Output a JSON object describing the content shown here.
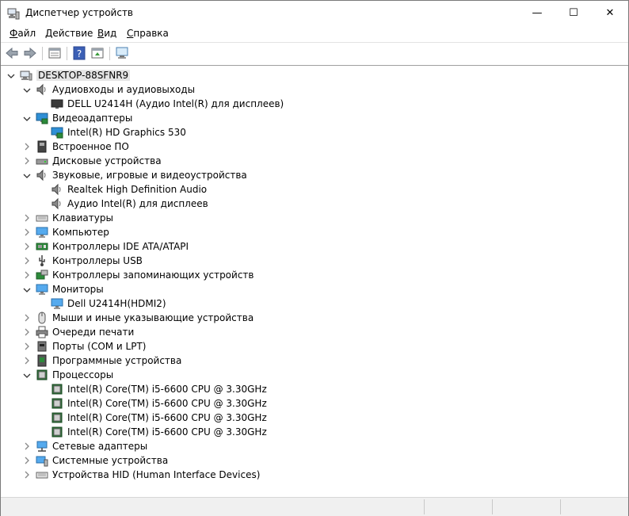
{
  "window": {
    "title": "Диспетчер устройств",
    "minimize_glyph": "—",
    "maximize_glyph": "☐",
    "close_glyph": "✕"
  },
  "menu": [
    {
      "ul": "Ф",
      "rest": "айл"
    },
    {
      "ul": "Д",
      "rest": "ействие"
    },
    {
      "ul": "В",
      "rest": "ид"
    },
    {
      "ul": "С",
      "rest": "правка"
    }
  ],
  "toolbar": [
    "back-icon",
    "forward-icon",
    "properties-icon",
    "help-icon",
    "update-driver-icon",
    "scan-hardware-icon"
  ],
  "tree": {
    "root": "DESKTOP-88SFNR9",
    "nodes": [
      {
        "label": "Аудиовходы и аудиовыходы",
        "icon": "speaker-icon",
        "expanded": true,
        "children": [
          {
            "label": "DELL U2414H (Аудио Intel(R) для дисплеев)",
            "icon": "monitor-dark-icon"
          }
        ]
      },
      {
        "label": "Видеоадаптеры",
        "icon": "display-adapter-icon",
        "expanded": true,
        "children": [
          {
            "label": "Intel(R) HD Graphics 530",
            "icon": "display-adapter-icon"
          }
        ]
      },
      {
        "label": "Встроенное ПО",
        "icon": "firmware-icon",
        "expanded": false,
        "children": []
      },
      {
        "label": "Дисковые устройства",
        "icon": "disk-icon",
        "expanded": false,
        "children": []
      },
      {
        "label": "Звуковые, игровые и видеоустройства",
        "icon": "speaker-icon",
        "expanded": true,
        "children": [
          {
            "label": "Realtek High Definition Audio",
            "icon": "speaker-icon"
          },
          {
            "label": "Аудио Intel(R) для дисплеев",
            "icon": "speaker-icon"
          }
        ]
      },
      {
        "label": "Клавиатуры",
        "icon": "keyboard-icon",
        "expanded": false,
        "children": []
      },
      {
        "label": "Компьютер",
        "icon": "computer-icon",
        "expanded": false,
        "children": []
      },
      {
        "label": "Контроллеры IDE ATA/ATAPI",
        "icon": "ide-controller-icon",
        "expanded": false,
        "children": []
      },
      {
        "label": "Контроллеры USB",
        "icon": "usb-icon",
        "expanded": false,
        "children": []
      },
      {
        "label": "Контроллеры запоминающих устройств",
        "icon": "storage-controller-icon",
        "expanded": false,
        "children": []
      },
      {
        "label": "Мониторы",
        "icon": "monitor-icon",
        "expanded": true,
        "children": [
          {
            "label": "Dell U2414H(HDMI2)",
            "icon": "monitor-icon"
          }
        ]
      },
      {
        "label": "Мыши и иные указывающие устройства",
        "icon": "mouse-icon",
        "expanded": false,
        "children": []
      },
      {
        "label": "Очереди печати",
        "icon": "printer-icon",
        "expanded": false,
        "children": []
      },
      {
        "label": "Порты (COM и LPT)",
        "icon": "port-icon",
        "expanded": false,
        "children": []
      },
      {
        "label": "Программные устройства",
        "icon": "software-device-icon",
        "expanded": false,
        "children": []
      },
      {
        "label": "Процессоры",
        "icon": "cpu-icon",
        "expanded": true,
        "children": [
          {
            "label": "Intel(R) Core(TM) i5-6600 CPU @ 3.30GHz",
            "icon": "cpu-icon"
          },
          {
            "label": "Intel(R) Core(TM) i5-6600 CPU @ 3.30GHz",
            "icon": "cpu-icon"
          },
          {
            "label": "Intel(R) Core(TM) i5-6600 CPU @ 3.30GHz",
            "icon": "cpu-icon"
          },
          {
            "label": "Intel(R) Core(TM) i5-6600 CPU @ 3.30GHz",
            "icon": "cpu-icon"
          }
        ]
      },
      {
        "label": "Сетевые адаптеры",
        "icon": "network-icon",
        "expanded": false,
        "children": []
      },
      {
        "label": "Системные устройства",
        "icon": "system-device-icon",
        "expanded": false,
        "children": []
      },
      {
        "label": "Устройства HID (Human Interface Devices)",
        "icon": "hid-icon",
        "expanded": false,
        "children": []
      }
    ]
  }
}
